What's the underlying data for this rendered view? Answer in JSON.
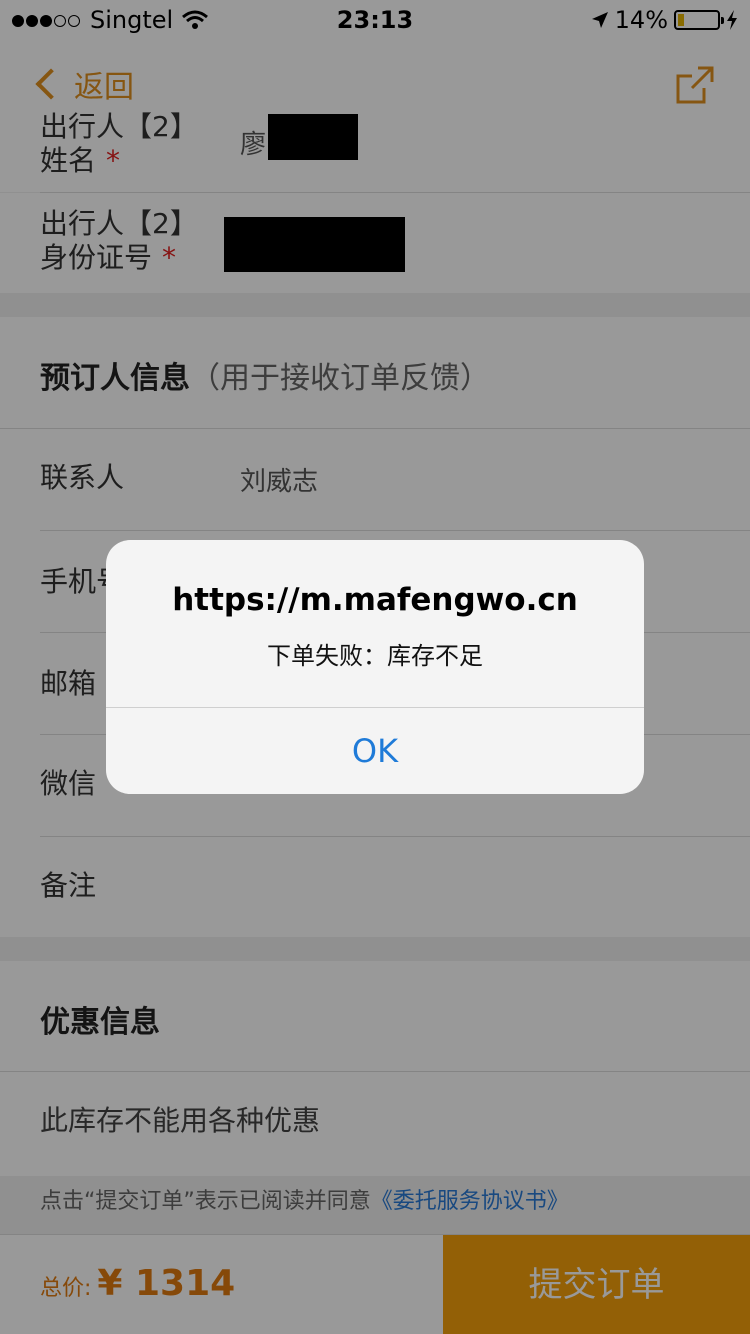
{
  "status_bar": {
    "carrier": "Singtel",
    "time": "23:13",
    "battery": "14%"
  },
  "nav": {
    "back_label": "返回"
  },
  "traveler2": {
    "name_label_line1": "出行人【2】",
    "name_label_line2": "姓名",
    "name_value": "廖",
    "id_label_line1": "出行人【2】",
    "id_label_line2": "身份证号",
    "required_mark": "*"
  },
  "booker": {
    "title": "预订人信息",
    "subtitle": "（用于接收订单反馈）",
    "contact_label": "联系人",
    "contact_value": "刘威志",
    "phone_label": "手机号",
    "email_label": "邮箱",
    "wechat_label": "微信",
    "remark_label": "备注"
  },
  "discount": {
    "title": "优惠信息",
    "note": "此库存不能用各种优惠"
  },
  "agreement": {
    "prefix": "点击“提交订单”表示已阅读并同意",
    "link": "《委托服务协议书》"
  },
  "footer": {
    "total_label": "总价:",
    "amount": "¥ 1314",
    "submit_label": "提交订单"
  },
  "alert": {
    "title": "https://m.mafengwo.cn",
    "message": "下单失败：库存不足",
    "ok_label": "OK"
  },
  "colors": {
    "accent": "#f5a00a",
    "link": "#1f7bd8",
    "required": "#e02020"
  }
}
